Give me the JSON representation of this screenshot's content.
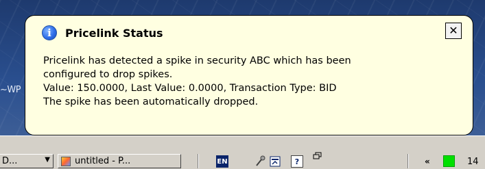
{
  "notification": {
    "title": "Pricelink Status",
    "close_label": "✕",
    "body_lines": [
      "Pricelink has detected a spike in security ABC which has been",
      "configured to drop spikes.",
      "Value: 150.0000, Last Value: 0.0000, Transaction Type: BID",
      "The spike has been automatically dropped."
    ]
  },
  "desktop": {
    "fragment_text": "~WP"
  },
  "taskbar": {
    "left_button_label": "D...",
    "paint_button_label": "untitled - P...",
    "language_indicator": "EN",
    "collapse_glyph": "«",
    "clock_fragment": "14"
  },
  "colors": {
    "balloon_background": "#ffffe1",
    "taskbar": "#d4d0c8",
    "status_green": "#00e000"
  },
  "icons": [
    "info-icon",
    "close-icon",
    "paint-icon",
    "microphone-icon",
    "tray-app-icon",
    "help-icon",
    "status-indicator-icon"
  ]
}
